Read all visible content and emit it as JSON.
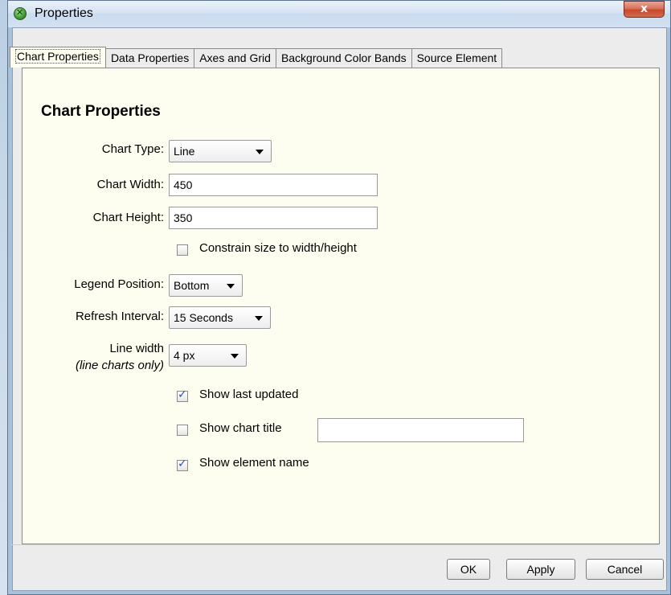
{
  "window": {
    "title": "Properties",
    "close_glyph": "x"
  },
  "tabs": [
    {
      "label": "Chart Properties",
      "active": true
    },
    {
      "label": "Data Properties",
      "active": false
    },
    {
      "label": "Axes and Grid",
      "active": false
    },
    {
      "label": "Background Color Bands",
      "active": false
    },
    {
      "label": "Source Element",
      "active": false
    }
  ],
  "panel": {
    "heading": "Chart Properties",
    "chart_type": {
      "label": "Chart Type:",
      "value": "Line"
    },
    "chart_width": {
      "label": "Chart Width:",
      "value": "450"
    },
    "chart_height": {
      "label": "Chart Height:",
      "value": "350"
    },
    "constrain": {
      "label": "Constrain size to width/height",
      "checked": false
    },
    "legend_position": {
      "label": "Legend Position:",
      "value": "Bottom"
    },
    "refresh_interval": {
      "label": "Refresh Interval:",
      "value": "15 Seconds"
    },
    "line_width": {
      "label": "Line width",
      "note": "(line charts only)",
      "value": "4 px"
    },
    "show_last_updated": {
      "label": "Show last updated",
      "checked": true
    },
    "show_chart_title": {
      "label": "Show chart title",
      "checked": false,
      "value": ""
    },
    "show_element_name": {
      "label": "Show element name",
      "checked": true
    }
  },
  "buttons": {
    "ok": "OK",
    "apply": "Apply",
    "cancel": "Cancel"
  },
  "colors": {
    "panel_bg": "#fefef0",
    "checkmark": "#2f55a9",
    "close_button": "#c6482c"
  }
}
